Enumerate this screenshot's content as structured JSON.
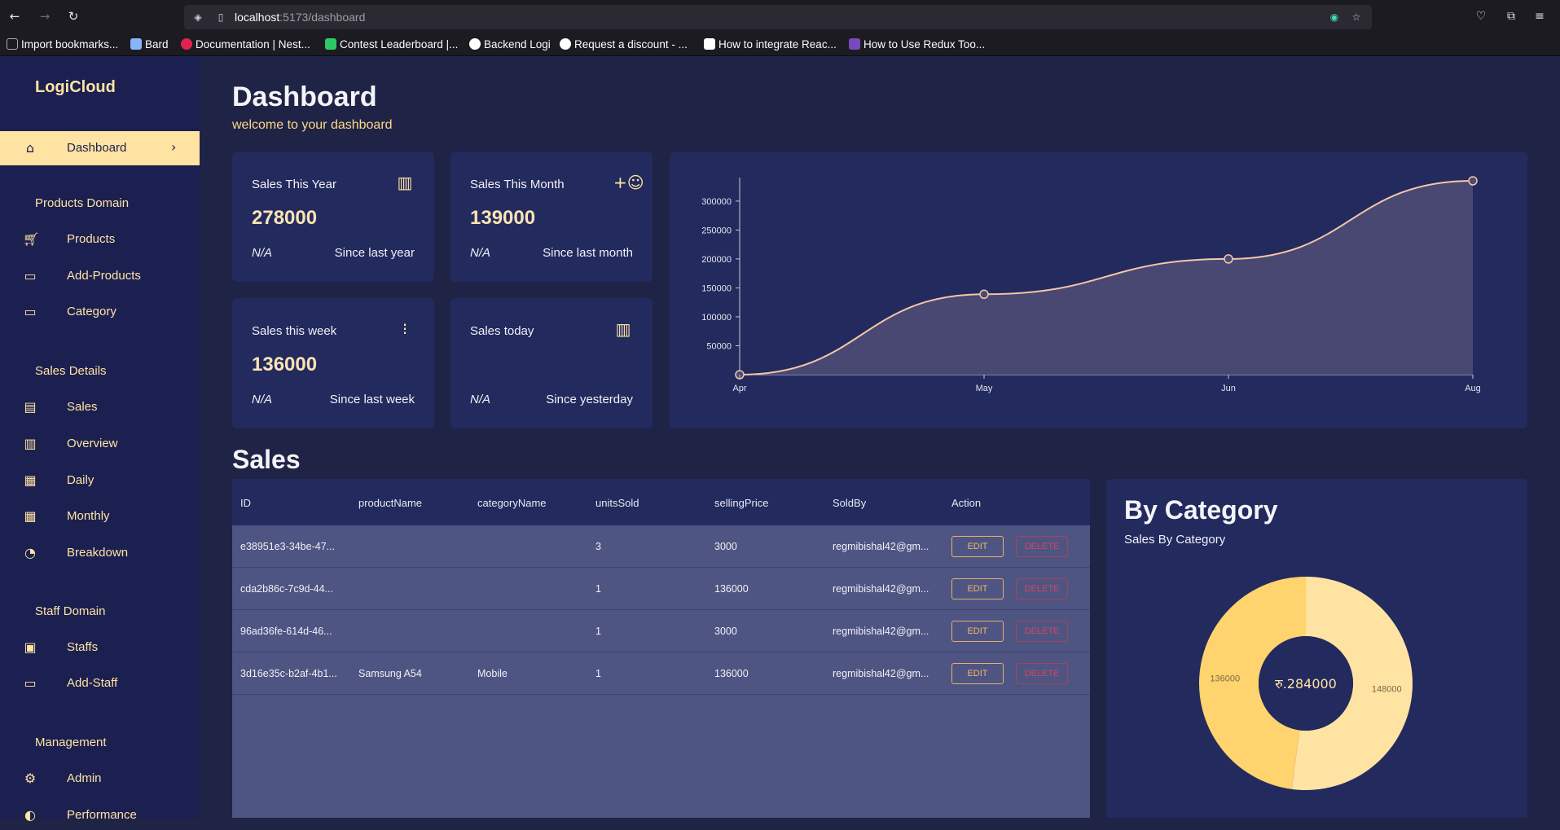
{
  "browser": {
    "url_host": "localhost",
    "url_path": ":5173/dashboard",
    "bookmarks": [
      {
        "label": "Import bookmarks...",
        "color": "#aaaaaa"
      },
      {
        "label": "Bard",
        "color": "#8ab4f8"
      },
      {
        "label": "Documentation | Nest...",
        "color": "#e0234e"
      },
      {
        "label": "Contest Leaderboard |...",
        "color": "#2ec866"
      },
      {
        "label": "Backend Logi",
        "color": "#ffffff"
      },
      {
        "label": "Request a discount - ...",
        "color": "#ffffff"
      },
      {
        "label": "How to integrate Reac...",
        "color": "#ffffff"
      },
      {
        "label": "How to Use Redux Too...",
        "color": "#764abc"
      }
    ]
  },
  "sidebar": {
    "brand": "LogiCloud",
    "active": {
      "label": "Dashboard",
      "icon": "home-icon"
    },
    "sections": {
      "products": "Products Domain",
      "sales": "Sales Details",
      "staff": "Staff Domain",
      "management": "Management"
    },
    "items": {
      "products": "Products",
      "add_products": "Add-Products",
      "category": "Category",
      "sales": "Sales",
      "overview": "Overview",
      "daily": "Daily",
      "monthly": "Monthly",
      "breakdown": "Breakdown",
      "staffs": "Staffs",
      "add_staff": "Add-Staff",
      "admin": "Admin",
      "performance": "Performance"
    }
  },
  "header": {
    "title": "Dashboard",
    "subtitle": "welcome to your dashboard"
  },
  "stats": [
    {
      "title": "Sales This Year",
      "value": "278000",
      "change": "N/A",
      "since": "Since last year",
      "icon": "cash-register-icon"
    },
    {
      "title": "Sales This Month",
      "value": "139000",
      "change": "N/A",
      "since": "Since last month",
      "icon": "person-add-icon"
    },
    {
      "title": "Sales this week",
      "value": "136000",
      "change": "N/A",
      "since": "Since last week",
      "icon": "traffic-icon"
    },
    {
      "title": "Sales today",
      "value": "",
      "change": "N/A",
      "since": "Since yesterday",
      "icon": "cash-register-icon"
    }
  ],
  "sales_section": {
    "title": "Sales",
    "columns": [
      "ID",
      "productName",
      "categoryName",
      "unitsSold",
      "sellingPrice",
      "SoldBy",
      "Action"
    ],
    "rows": [
      {
        "id": "e38951e3-34be-47...",
        "product": "",
        "category": "",
        "units": "3",
        "price": "3000",
        "soldby": "regmibishal42@gm..."
      },
      {
        "id": "cda2b86c-7c9d-44...",
        "product": "",
        "category": "",
        "units": "1",
        "price": "136000",
        "soldby": "regmibishal42@gm..."
      },
      {
        "id": "96ad36fe-614d-46...",
        "product": "",
        "category": "",
        "units": "1",
        "price": "3000",
        "soldby": "regmibishal42@gm..."
      },
      {
        "id": "3d16e35c-b2af-4b1...",
        "product": "Samsung A54",
        "category": "Mobile",
        "units": "1",
        "price": "136000",
        "soldby": "regmibishal42@gm..."
      }
    ],
    "edit_label": "EDIT",
    "delete_label": "DELETE"
  },
  "category": {
    "title": "By Category",
    "subtitle": "Sales By Category",
    "total": "रु.284000"
  },
  "colors": {
    "accent": "#ffe3a3",
    "bg": "#1f2346",
    "card": "#222a5e",
    "line": "#f5c6a8",
    "pie1": "#ffd36e",
    "pie2": "#ffe3a3"
  },
  "chart_data": [
    {
      "type": "area",
      "x": [
        "Apr",
        "May",
        "Jun",
        "Aug"
      ],
      "values": [
        0,
        139000,
        200000,
        335000
      ],
      "yticks": [
        50000,
        100000,
        150000,
        200000,
        250000,
        300000
      ],
      "ylim": [
        0,
        335000
      ]
    },
    {
      "type": "pie",
      "categories": [
        "136000",
        "148000"
      ],
      "values": [
        136000,
        148000
      ]
    }
  ]
}
